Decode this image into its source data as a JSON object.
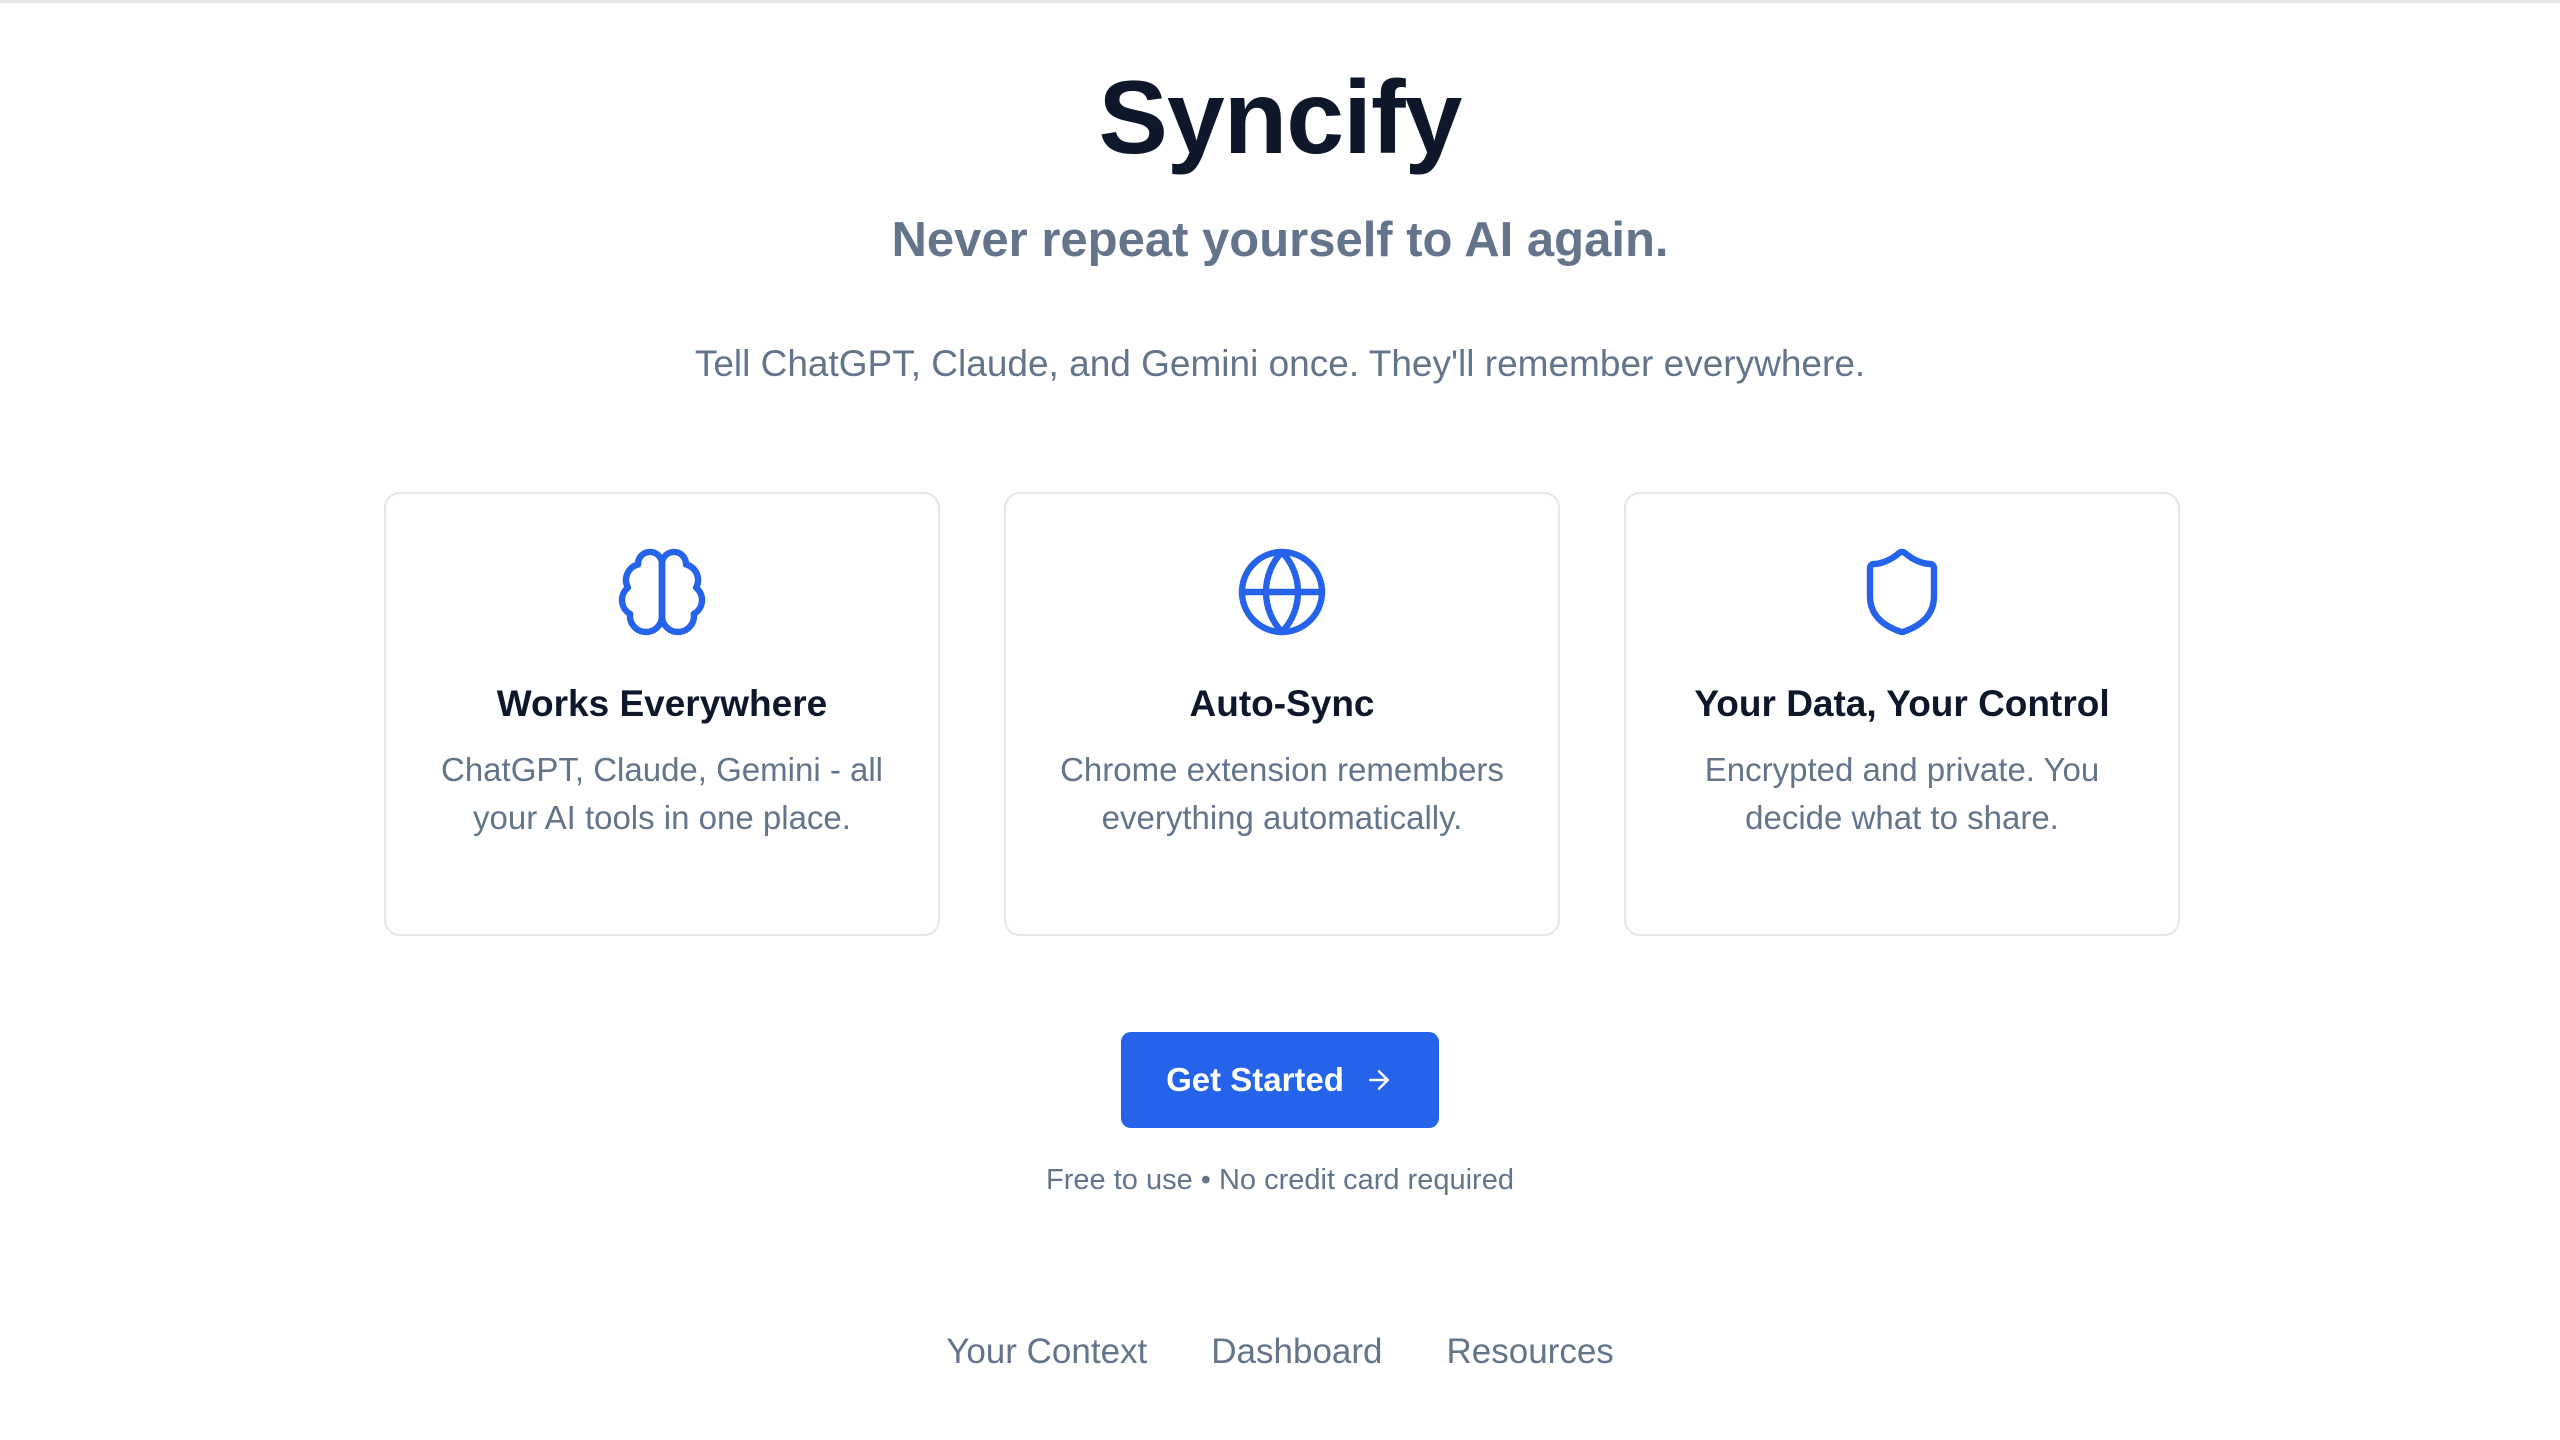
{
  "brand": {
    "name": "Syncify"
  },
  "hero": {
    "tagline": "Never repeat yourself to AI again.",
    "subtext": "Tell ChatGPT, Claude, and Gemini once. They'll remember everywhere."
  },
  "features": [
    {
      "icon": "brain-icon",
      "title": "Works Everywhere",
      "description": "ChatGPT, Claude, Gemini - all your AI tools in one place."
    },
    {
      "icon": "globe-icon",
      "title": "Auto-Sync",
      "description": "Chrome extension remembers everything automatically."
    },
    {
      "icon": "shield-icon",
      "title": "Your Data, Your Control",
      "description": "Encrypted and private. You decide what to share."
    }
  ],
  "cta": {
    "label": "Get Started",
    "icon": "arrow-right-icon"
  },
  "fineprint": "Free to use • No credit card required",
  "footer": {
    "links": [
      "Your Context",
      "Dashboard",
      "Resources"
    ]
  },
  "colors": {
    "accent": "#2563eb",
    "heading": "#0f172a",
    "muted": "#64748b",
    "border": "#e5e7eb"
  }
}
